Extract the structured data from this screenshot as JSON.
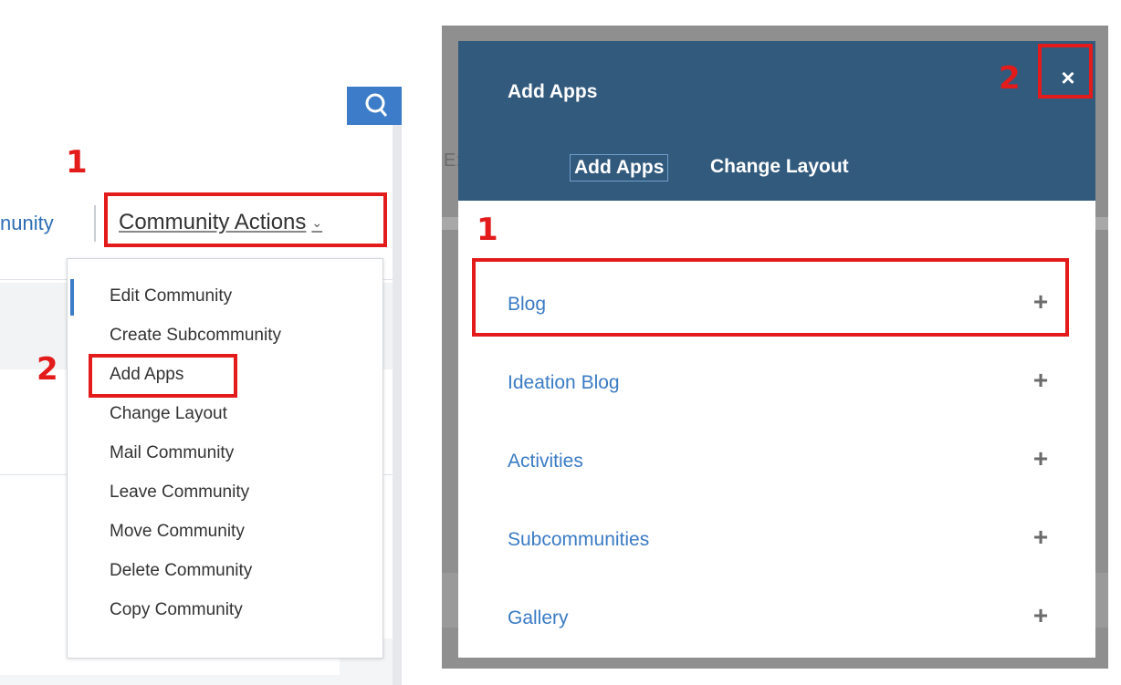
{
  "left": {
    "nav_label": "nunity",
    "actions_label": "Community Actions",
    "actions_chevron": "⌄",
    "menu_items": [
      "Edit Community",
      "Create Subcommunity",
      "Add Apps",
      "Change Layout",
      "Mail Community",
      "Leave Community",
      "Move Community",
      "Delete Community",
      "Copy Community"
    ],
    "annotation_step1": "1",
    "annotation_step2": "2"
  },
  "dialog": {
    "title": "Add Apps",
    "close_label": "×",
    "tabs": [
      {
        "label": "Add Apps",
        "selected": true
      },
      {
        "label": "Change Layout",
        "selected": false
      }
    ],
    "apps": [
      {
        "name": "Blog",
        "add_label": "+"
      },
      {
        "name": "Ideation Blog",
        "add_label": "+"
      },
      {
        "name": "Activities",
        "add_label": "+"
      },
      {
        "name": "Subcommunities",
        "add_label": "+"
      },
      {
        "name": "Gallery",
        "add_label": "+"
      }
    ],
    "annotation_step1": "1",
    "annotation_step2": "2",
    "edge_glyph": "E:"
  },
  "colors": {
    "annotation": "#e31b1b",
    "header": "#325a7d",
    "link": "#3a7bc4",
    "search": "#3c7cc8"
  },
  "icons": {
    "search": "search-icon",
    "close": "close-icon",
    "add": "plus-icon",
    "chevron": "chevron-down-icon"
  }
}
